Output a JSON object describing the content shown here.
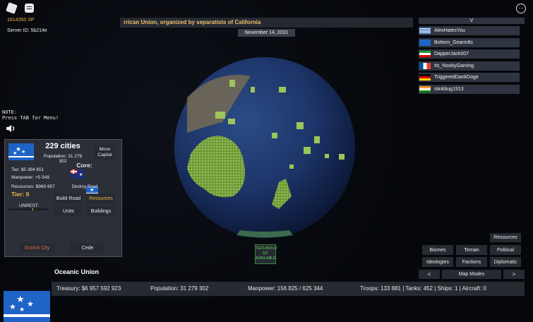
{
  "top_left": {
    "xp": "1614350 XP",
    "server_id": "Server ID: 5b214e"
  },
  "news_ticker": "rrican Union, organized by separatists of California",
  "date": "November 14, 2031",
  "note": {
    "line1": "NOTE:",
    "line2": "Press TAB for Menu!"
  },
  "player_list": {
    "header": "V",
    "players": [
      {
        "name": "AlexHatesYou",
        "flag": "flag-icon-greece"
      },
      {
        "name": "Bottom_Gearm8s",
        "flag": "flag-icon-oceanic"
      },
      {
        "name": "DapperJack007",
        "flag": "flag-icon-iran"
      },
      {
        "name": "Its_NoobyGaming",
        "flag": "flag-icon-france"
      },
      {
        "name": "TriggeredDankDoge",
        "flag": "flag-icon-germany"
      },
      {
        "name": "stinkbug1913",
        "flag": "flag-icon-india"
      }
    ]
  },
  "country_panel": {
    "cities": "229 cities",
    "population": "Population: 31 279 302",
    "move_capital": "Move Capital",
    "tax": "Tax: $5 384 651",
    "manpower": "Manpower: +5 549",
    "resources": "Resources: $968 657",
    "tier": "Tier: II",
    "unrest_label": "UNREST:",
    "core_label": "Core:",
    "destroy_road": "Destroy Road",
    "build_road": "Build Road",
    "resources_button": "Resources",
    "units": "Units",
    "buildings": "Buildings",
    "scorch_city": "Scorch City",
    "cede": "Cede"
  },
  "technology": {
    "line1": "TECHNOLO",
    "line2": "GY",
    "line3": "AVAILABLE"
  },
  "map_modes": {
    "resources": "Resources",
    "biomes": "Biomes",
    "terrain": "Terrain",
    "political": "Political",
    "ideologies": "Ideologies",
    "factions": "Factions",
    "diplomatic": "Diplomatic",
    "prev": "<",
    "label": "Map Modes",
    "next": ">"
  },
  "country": {
    "name": "Oceanic Union"
  },
  "bottom_bar": {
    "treasury": "Treasury:  $6 957 592 923",
    "population": "Population: 31 279 302",
    "manpower": "Manpower:  156 825  /  625 344",
    "military": "Troops: 133 881  |  Tanks: 452  |  Ships: 1  |  Aircraft: 0"
  },
  "colors": {
    "accent_gold": "#e8b54a",
    "ocean_flag_blue": "#1e63c6",
    "tech_green": "#5fd35f",
    "news_text": "#f0c070"
  }
}
